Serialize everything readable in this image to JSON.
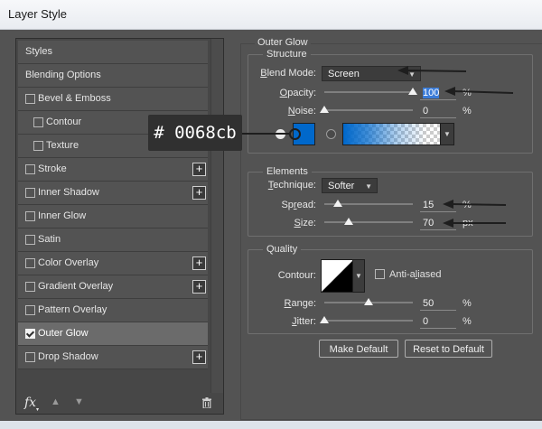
{
  "window": {
    "title": "Layer Style"
  },
  "styles_panel": {
    "items": [
      {
        "label": "Styles",
        "checkbox": false,
        "checked": false,
        "indent": false,
        "add": false,
        "selected": false
      },
      {
        "label": "Blending Options",
        "checkbox": false,
        "checked": false,
        "indent": false,
        "add": false,
        "selected": false
      },
      {
        "label": "Bevel & Emboss",
        "checkbox": true,
        "checked": false,
        "indent": false,
        "add": false,
        "selected": false
      },
      {
        "label": "Contour",
        "checkbox": true,
        "checked": false,
        "indent": true,
        "add": false,
        "selected": false
      },
      {
        "label": "Texture",
        "checkbox": true,
        "checked": false,
        "indent": true,
        "add": false,
        "selected": false
      },
      {
        "label": "Stroke",
        "checkbox": true,
        "checked": false,
        "indent": false,
        "add": true,
        "selected": false
      },
      {
        "label": "Inner Shadow",
        "checkbox": true,
        "checked": false,
        "indent": false,
        "add": true,
        "selected": false
      },
      {
        "label": "Inner Glow",
        "checkbox": true,
        "checked": false,
        "indent": false,
        "add": false,
        "selected": false
      },
      {
        "label": "Satin",
        "checkbox": true,
        "checked": false,
        "indent": false,
        "add": false,
        "selected": false
      },
      {
        "label": "Color Overlay",
        "checkbox": true,
        "checked": false,
        "indent": false,
        "add": true,
        "selected": false
      },
      {
        "label": "Gradient Overlay",
        "checkbox": true,
        "checked": false,
        "indent": false,
        "add": true,
        "selected": false
      },
      {
        "label": "Pattern Overlay",
        "checkbox": true,
        "checked": false,
        "indent": false,
        "add": false,
        "selected": false
      },
      {
        "label": "Outer Glow",
        "checkbox": true,
        "checked": true,
        "indent": false,
        "add": false,
        "selected": true
      },
      {
        "label": "Drop Shadow",
        "checkbox": true,
        "checked": false,
        "indent": false,
        "add": true,
        "selected": false
      }
    ],
    "add_symbol": "+",
    "footer": {
      "fx_label": "fx",
      "fx_arrow": "▾",
      "up_arrow": "▲",
      "down_arrow": "▼"
    }
  },
  "outer_glow": {
    "title": "Outer Glow",
    "structure": {
      "title": "Structure",
      "blend_mode": {
        "label": "Blend Mode:",
        "mnemonic": "B",
        "rest": "lend Mode:",
        "value": "Screen"
      },
      "opacity": {
        "label": "Opacity:",
        "mnemonic": "O",
        "rest": "pacity:",
        "value": "100",
        "unit": "%",
        "slider": 1.0
      },
      "noise": {
        "label": "Noise:",
        "mnemonic": "N",
        "rest": "oise:",
        "value": "0",
        "unit": "%",
        "slider": 0.0
      },
      "color": "#0068cb",
      "color_mode": "solid"
    },
    "elements": {
      "title": "Elements",
      "technique": {
        "label": "Technique:",
        "mnemonic": "T",
        "rest": "echnique:",
        "value": "Softer"
      },
      "spread": {
        "label": "Spread:",
        "pre": "Sp",
        "mnemonic": "r",
        "rest": "ead:",
        "value": "15",
        "unit": "%",
        "slider": 0.15
      },
      "size": {
        "label": "Size:",
        "mnemonic": "S",
        "rest": "ize:",
        "value": "70",
        "unit": "px",
        "slider": 0.28
      }
    },
    "quality": {
      "title": "Quality",
      "contour": {
        "label": "Contour:"
      },
      "anti_aliased": {
        "label": "Anti-aliased",
        "pre": "Anti-a",
        "mnemonic": "l",
        "rest": "iased",
        "checked": false
      },
      "range": {
        "label": "Range:",
        "mnemonic": "R",
        "rest": "ange:",
        "value": "50",
        "unit": "%",
        "slider": 0.5
      },
      "jitter": {
        "label": "Jitter:",
        "mnemonic": "J",
        "rest": "itter:",
        "value": "0",
        "unit": "%",
        "slider": 0.0
      }
    },
    "buttons": {
      "make_default": "Make Default",
      "reset_default": "Reset to Default"
    }
  },
  "annotation": {
    "callout_text": "# 0068cb"
  },
  "colors": {
    "panel_bg": "#535353",
    "selected_row": "#6b6b6b",
    "highlight": "#3b7cd8",
    "glow_color": "#0068cb"
  }
}
